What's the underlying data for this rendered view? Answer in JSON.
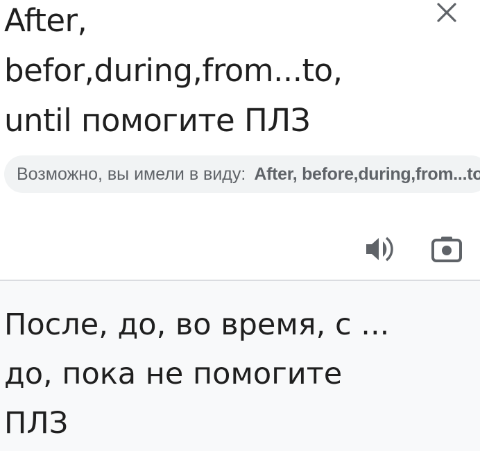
{
  "source": {
    "text": "After,\nbefor,during,from...to,\nuntil помогите ПЛЗ"
  },
  "suggestion": {
    "label": "Возможно, вы имели в виду:",
    "value": "After, before,during,from...to, until помогите ПЛЗ"
  },
  "icons": {
    "clear": "close-icon",
    "listen": "speaker-icon",
    "camera": "camera-icon"
  },
  "translation": {
    "text": "После, до, во время, с ...\nдо, пока не помогите\nПЛЗ"
  },
  "colors": {
    "text": "#1f1f1f",
    "muted": "#5f6368",
    "chip_bg": "#f1f3f4",
    "result_bg": "#f8f9fa",
    "divider": "#dadce0"
  }
}
